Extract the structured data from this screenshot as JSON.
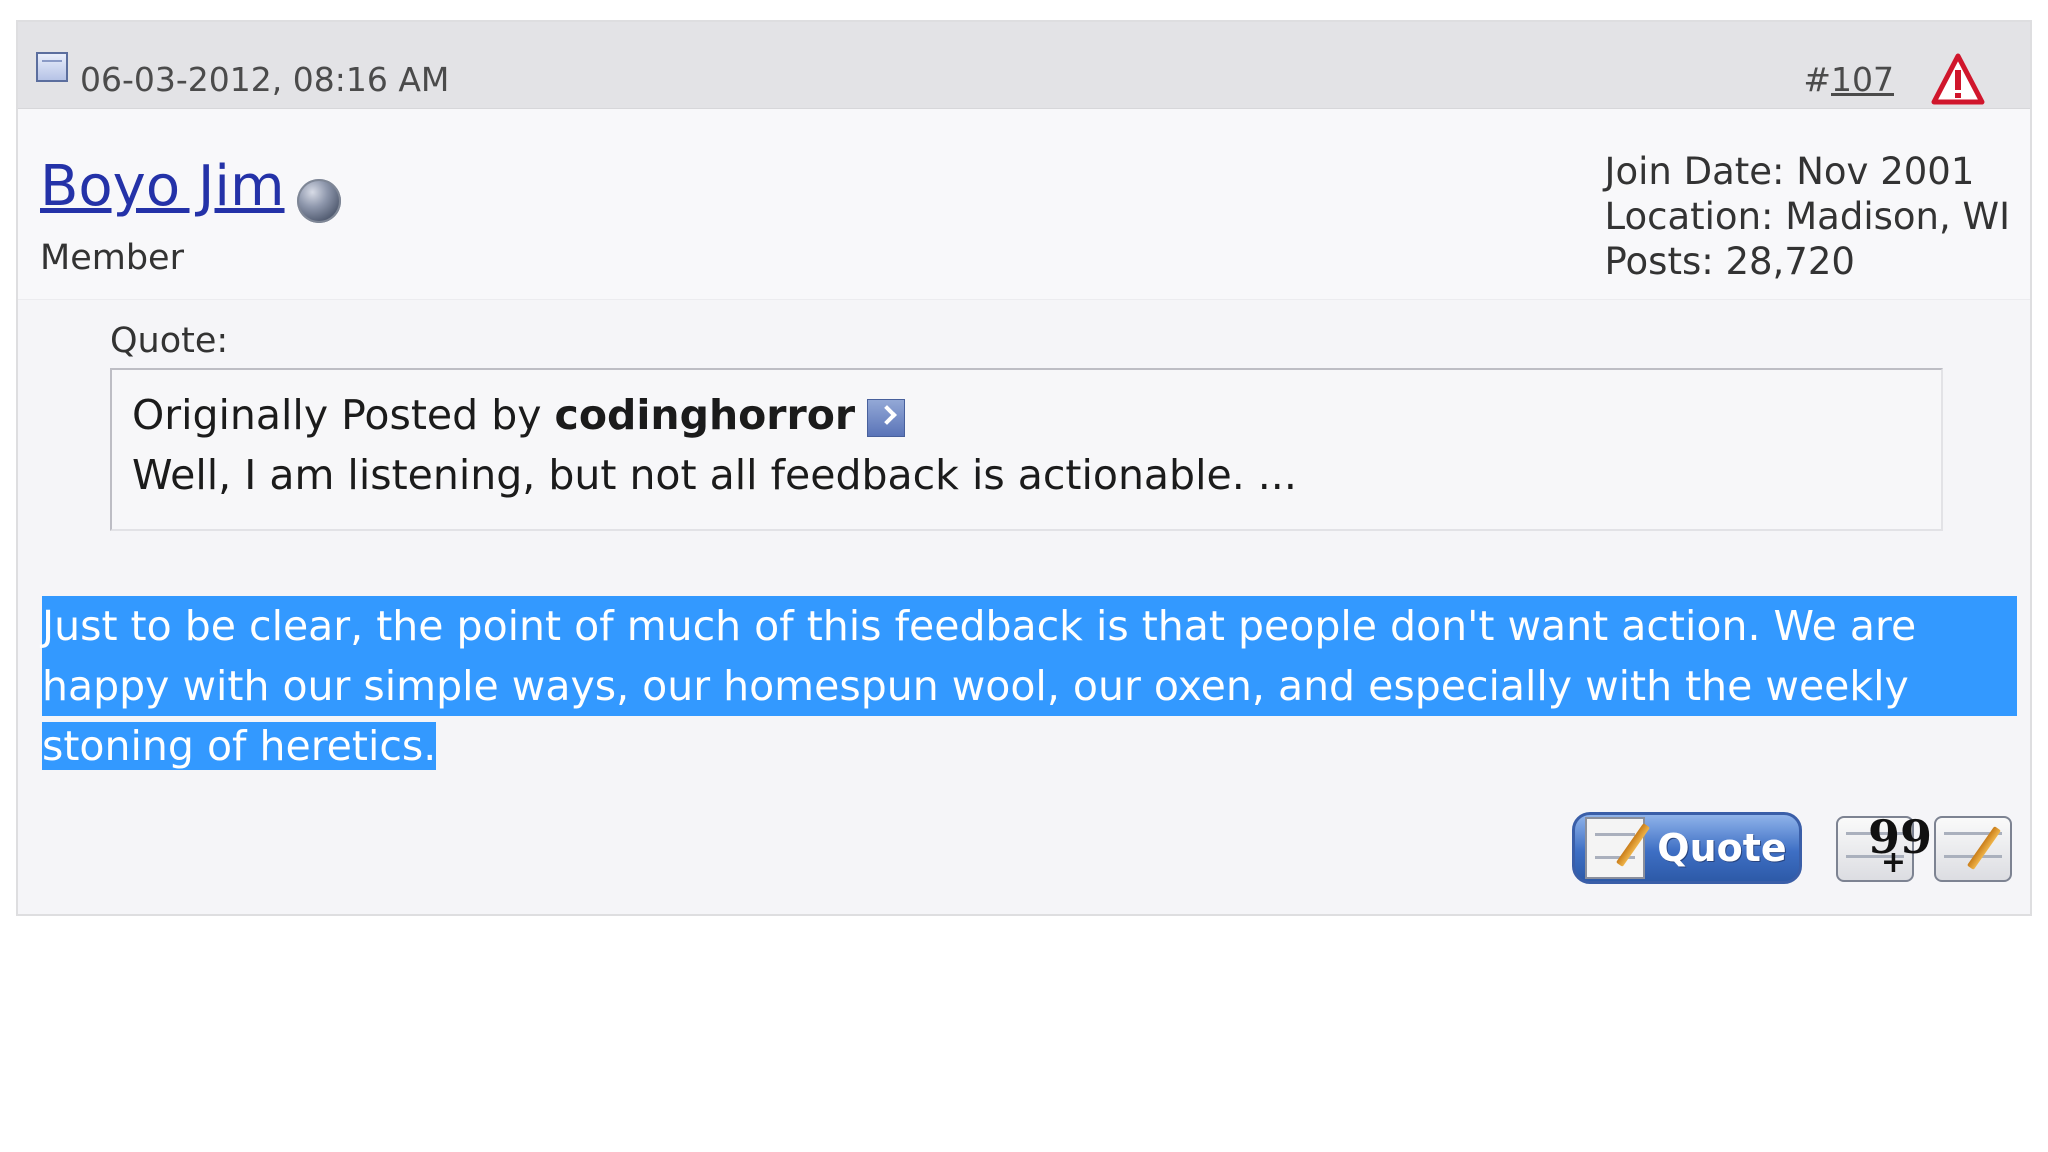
{
  "post": {
    "date": "06-03-2012, 08:16 AM",
    "number_prefix": "#",
    "number": "107"
  },
  "user": {
    "name": "Boyo Jim",
    "title": "Member",
    "join_date": "Join Date: Nov 2001",
    "location": "Location: Madison, WI",
    "posts": "Posts: 28,720"
  },
  "quote": {
    "label": "Quote:",
    "originally_posted_by": "Originally Posted by",
    "author": "codinghorror",
    "text": "Well, I am listening, but not all feedback is actionable. ..."
  },
  "message": {
    "lines": [
      "Just to be clear, the point of much of this feedback is that people don't want action. We are",
      "happy with our simple ways, our homespun wool, our oxen, and especially with the weekly",
      "stoning of heretics."
    ]
  },
  "buttons": {
    "quote_label": "Quote",
    "multiquote_marks": "99",
    "multiquote_plus": "+"
  },
  "colors": {
    "selection_highlight": "#3399ff",
    "username_link": "#2432a8",
    "report_icon": "#d0162c"
  },
  "icons": {
    "post_icon": "post-status-icon",
    "report": "report-warning-icon",
    "online_status": "user-offline-status-icon",
    "view_post": "view-post-arrow-icon",
    "quote_button": "quote-button-icon",
    "multiquote_button": "multiquote-icon",
    "edit_button": "quick-reply-icon"
  }
}
